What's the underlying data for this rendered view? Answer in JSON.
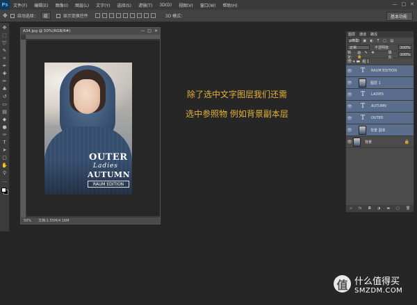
{
  "app": {
    "logo": "Ps"
  },
  "menubar": {
    "items": [
      "文件(F)",
      "编辑(E)",
      "图像(I)",
      "图层(L)",
      "文字(Y)",
      "选择(S)",
      "滤镜(T)",
      "3D(D)",
      "视图(V)",
      "窗口(W)",
      "帮助(H)"
    ],
    "window_controls": [
      "—",
      "□",
      "✕"
    ]
  },
  "options_bar": {
    "auto_select_label": "自动选择：",
    "auto_select_value": "组",
    "transform_label": "显示变换控件",
    "mode_3d_label": "3D 模式："
  },
  "workspace": {
    "value": "基本功能"
  },
  "document": {
    "title": "A34.jpg @ 50%(RGB/8#)",
    "controls": [
      "—",
      "□",
      "✕"
    ],
    "zoom": "50%",
    "doc_info": "文档:1.55M/4.16M"
  },
  "poster": {
    "outer": "OUTER",
    "ladies": "Ladies",
    "autumn": "AUTUMN",
    "raum": "RAUM EDITION"
  },
  "captions": [
    "除了选中文字图层我们还需",
    "选中参照物 例如背景副本层"
  ],
  "layers_panel": {
    "tabs": [
      "图层",
      "通道",
      "路径"
    ],
    "filter_label": "ρ类型",
    "blend_mode": "正常",
    "opacity_label": "不透明度:",
    "opacity_value": "100%",
    "lock_label": "锁定:",
    "fill_label": "填充:",
    "fill_value": "100%",
    "group_name": "组 1",
    "layers": [
      {
        "name": "RAUM EDITION",
        "kind": "text",
        "selected": true
      },
      {
        "name": "图层 1",
        "kind": "image",
        "selected": true
      },
      {
        "name": "LADIES",
        "kind": "text",
        "selected": true
      },
      {
        "name": "AUTUMN",
        "kind": "text",
        "selected": true
      },
      {
        "name": "OUTER",
        "kind": "text",
        "selected": true
      },
      {
        "name": "背景 副本",
        "kind": "image",
        "selected": true
      },
      {
        "name": "背景",
        "kind": "image",
        "selected": false,
        "locked": true
      }
    ]
  },
  "watermark": {
    "icon_char": "值",
    "text_cn": "什么值得买",
    "text_en": "SMZDM.COM"
  }
}
